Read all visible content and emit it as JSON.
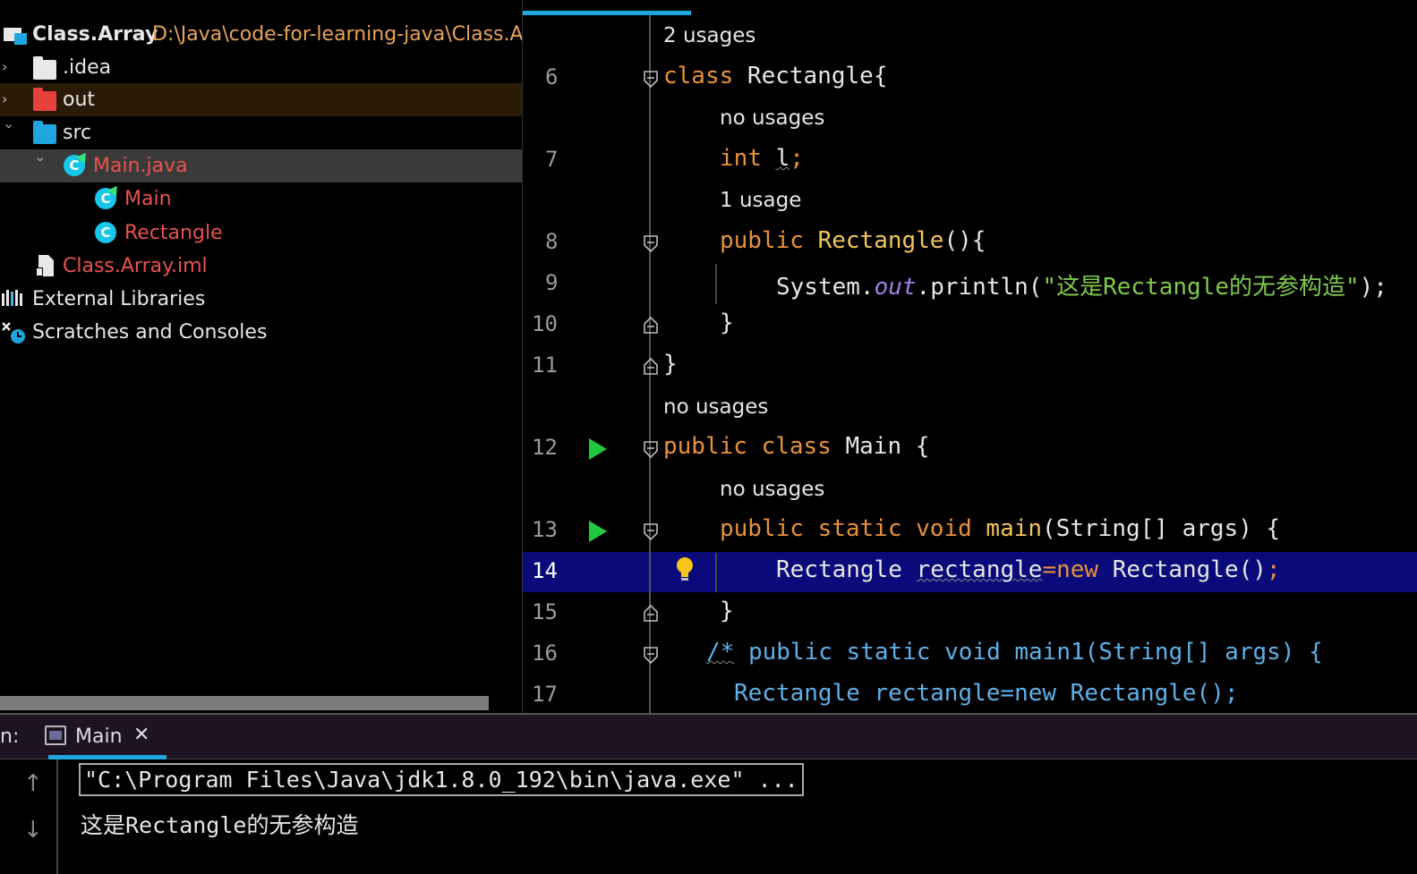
{
  "project_tree": {
    "root_name": "Class.Array",
    "root_path": "D:\\Java\\code-for-learning-java\\Class.Ar",
    "items": [
      {
        "label": ".idea"
      },
      {
        "label": "out"
      },
      {
        "label": "src"
      },
      {
        "label": "Main.java"
      },
      {
        "label": "Main"
      },
      {
        "label": "Rectangle"
      },
      {
        "label": "Class.Array.iml"
      },
      {
        "label": "External Libraries"
      },
      {
        "label": "Scratches and Consoles"
      }
    ]
  },
  "editor": {
    "hints": {
      "h1": "2 usages",
      "h2": "no usages",
      "h3": "1 usage",
      "h4": "no usages",
      "h5": "no usages"
    },
    "line_numbers": [
      "6",
      "7",
      "8",
      "9",
      "10",
      "11",
      "12",
      "13",
      "14",
      "15",
      "16",
      "17"
    ],
    "code": {
      "l6_kw": "class",
      "l6_rest": " Rectangle{",
      "l7_kw": "int",
      "l7_var": "l",
      "l7_semi": ";",
      "l8_kw": "public",
      "l8_name": "Rectangle",
      "l8_rest": "(){",
      "l9_a": "System.",
      "l9_out": "out",
      "l9_b": ".println(",
      "l9_str": "\"这是Rectangle的无参构造\"",
      "l9_c": ");",
      "l10": "}",
      "l11": "}",
      "l12_kw": "public class",
      "l12_rest": " Main {",
      "l13_kw": "public static void",
      "l13_fn": "main",
      "l13_rest": "(String[] args) {",
      "l14_a": "Rectangle ",
      "l14_var": "rectangle",
      "l14_eq": "=",
      "l14_new": "new",
      "l14_b": " Rectangle()",
      "l14_semi": ";",
      "l15": "}",
      "l16_open": "/*",
      "l16_rest": " public static void main1(String[] args) {",
      "l17": "Rectangle rectangle=new Rectangle();"
    },
    "current_line": "14"
  },
  "run_panel": {
    "prefix": "n:",
    "tab_label": "Main",
    "close_glyph": "✕",
    "up_glyph": "↑",
    "down_glyph": "↓",
    "console_lines": [
      "\"C:\\Program Files\\Java\\jdk1.8.0_192\\bin\\java.exe\" ...",
      "这是Rectangle的无参构造"
    ]
  },
  "colors": {
    "keyword": "#e8913a",
    "string": "#7fc94a",
    "current_line": "#0a0a7a",
    "accent": "#1fa6e0"
  }
}
